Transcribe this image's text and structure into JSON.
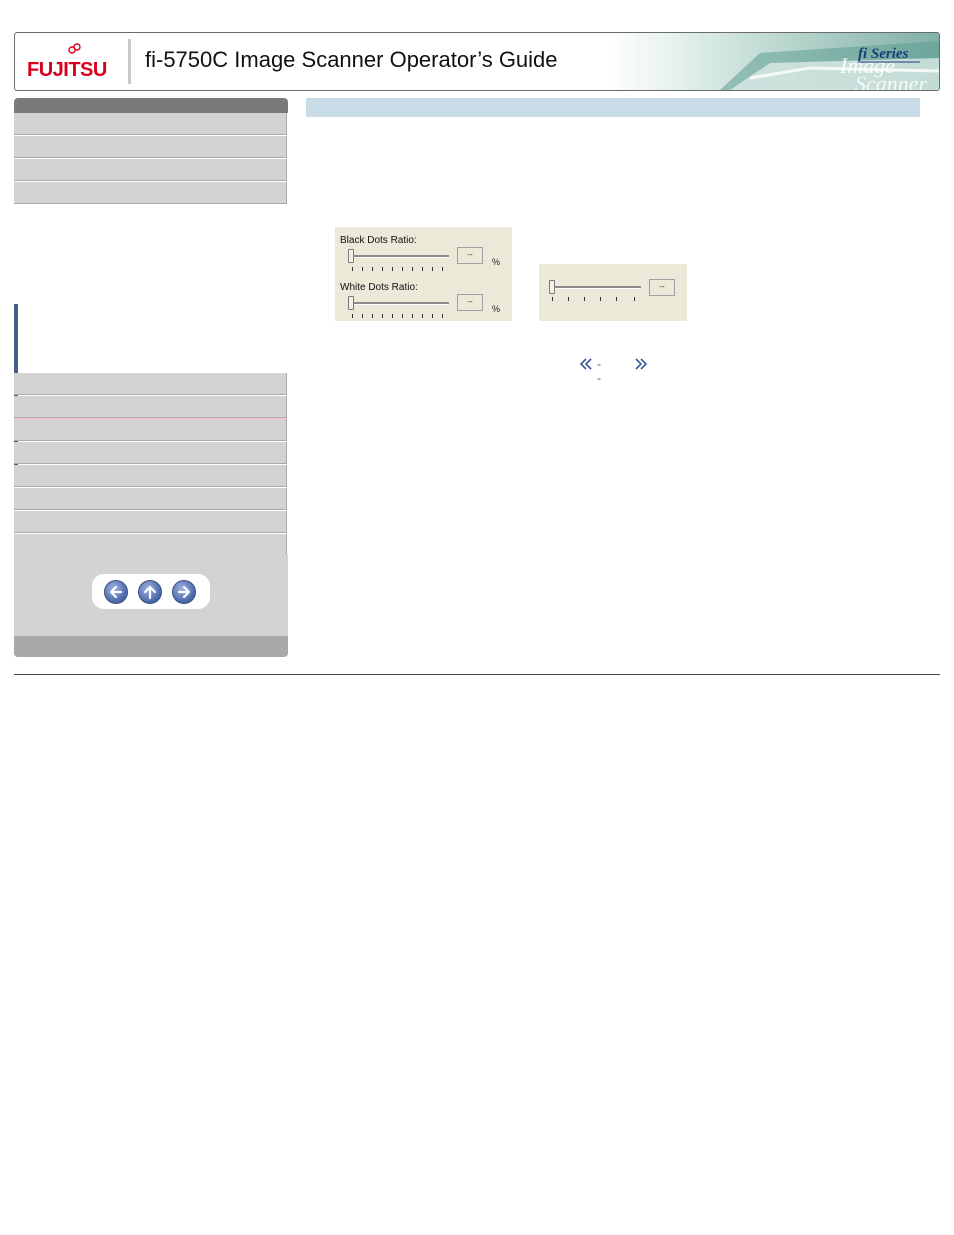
{
  "header": {
    "logo_text": "FUJITSU",
    "title": "fi-5750C Image Scanner Operator’s Guide",
    "series_badge": "fi Series",
    "art_words": [
      "Image",
      "Scanner"
    ],
    "brand_color": "#d9001b"
  },
  "sidebar": {
    "nav_items_top_count_hint": "",
    "active_color": "#ffc0c8",
    "accent_color": "#4a5e8c"
  },
  "navigation": {
    "prev_icon": "arrow-left-icon",
    "up_icon": "arrow-up-icon",
    "next_icon": "arrow-right-icon"
  },
  "panel_dots": {
    "black_label": "Black Dots Ratio:",
    "black_value": "--",
    "white_label": "White Dots Ratio:",
    "white_value": "--",
    "unit": "%"
  },
  "panel_slider": {
    "value": "--"
  },
  "pager": {
    "prev_icon": "double-chevron-left-icon",
    "separator": "- -",
    "next_icon": "double-chevron-right-icon"
  }
}
